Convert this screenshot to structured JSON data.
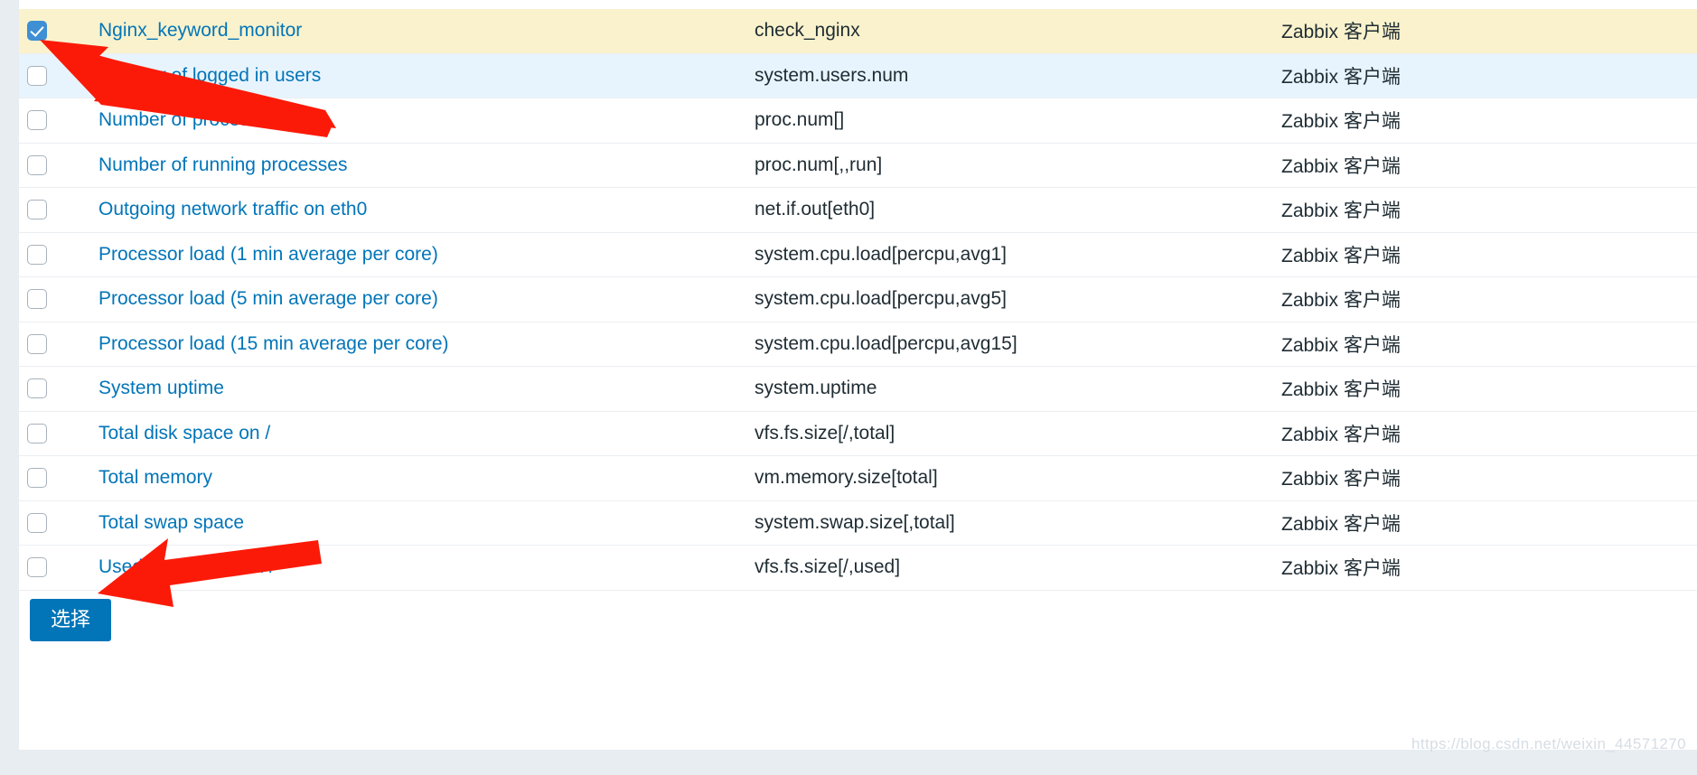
{
  "colors": {
    "accent": "#0275b8",
    "selected_row": "#faf2cc",
    "hover_row": "#e8f4fd",
    "link": "#0275b8",
    "checkbox_checked": "#3e8fd4",
    "annotation_arrow": "#fb1a08",
    "page_gutter": "#e8edf2",
    "row_divider": "#ebeef2"
  },
  "table": {
    "columns": [
      {
        "key": "checkbox",
        "label": ""
      },
      {
        "key": "name",
        "label": ""
      },
      {
        "key": "item_key",
        "label": ""
      },
      {
        "key": "type",
        "label": ""
      }
    ],
    "rows": [
      {
        "name": "Nginx_keyword_monitor",
        "item_key": "check_nginx",
        "type": "Zabbix 客户端",
        "checked": true,
        "state": "selected"
      },
      {
        "name": "Number of logged in users",
        "item_key": "system.users.num",
        "type": "Zabbix 客户端",
        "checked": false,
        "state": "hover"
      },
      {
        "name": "Number of processes",
        "item_key": "proc.num[]",
        "type": "Zabbix 客户端",
        "checked": false,
        "state": "plain"
      },
      {
        "name": "Number of running processes",
        "item_key": "proc.num[,,run]",
        "type": "Zabbix 客户端",
        "checked": false,
        "state": "plain"
      },
      {
        "name": "Outgoing network traffic on eth0",
        "item_key": "net.if.out[eth0]",
        "type": "Zabbix 客户端",
        "checked": false,
        "state": "plain"
      },
      {
        "name": "Processor load (1 min average per core)",
        "item_key": "system.cpu.load[percpu,avg1]",
        "type": "Zabbix 客户端",
        "checked": false,
        "state": "plain"
      },
      {
        "name": "Processor load (5 min average per core)",
        "item_key": "system.cpu.load[percpu,avg5]",
        "type": "Zabbix 客户端",
        "checked": false,
        "state": "plain"
      },
      {
        "name": "Processor load (15 min average per core)",
        "item_key": "system.cpu.load[percpu,avg15]",
        "type": "Zabbix 客户端",
        "checked": false,
        "state": "plain"
      },
      {
        "name": "System uptime",
        "item_key": "system.uptime",
        "type": "Zabbix 客户端",
        "checked": false,
        "state": "plain"
      },
      {
        "name": "Total disk space on /",
        "item_key": "vfs.fs.size[/,total]",
        "type": "Zabbix 客户端",
        "checked": false,
        "state": "plain"
      },
      {
        "name": "Total memory",
        "item_key": "vm.memory.size[total]",
        "type": "Zabbix 客户端",
        "checked": false,
        "state": "plain"
      },
      {
        "name": "Total swap space",
        "item_key": "system.swap.size[,total]",
        "type": "Zabbix 客户端",
        "checked": false,
        "state": "plain"
      },
      {
        "name": "Used disk space on /",
        "item_key": "vfs.fs.size[/,used]",
        "type": "Zabbix 客户端",
        "checked": false,
        "state": "plain"
      }
    ]
  },
  "footer": {
    "select_label": "选择"
  },
  "annotations": [
    {
      "name": "arrow-to-selected-checkbox",
      "points_at": "Nginx_keyword_monitor checkbox",
      "color": "#fb1a08"
    },
    {
      "name": "arrow-to-select-button",
      "points_at": "选择 button",
      "color": "#fb1a08"
    }
  ],
  "watermark": {
    "text": "https://blog.csdn.net/weixin_44571270"
  }
}
